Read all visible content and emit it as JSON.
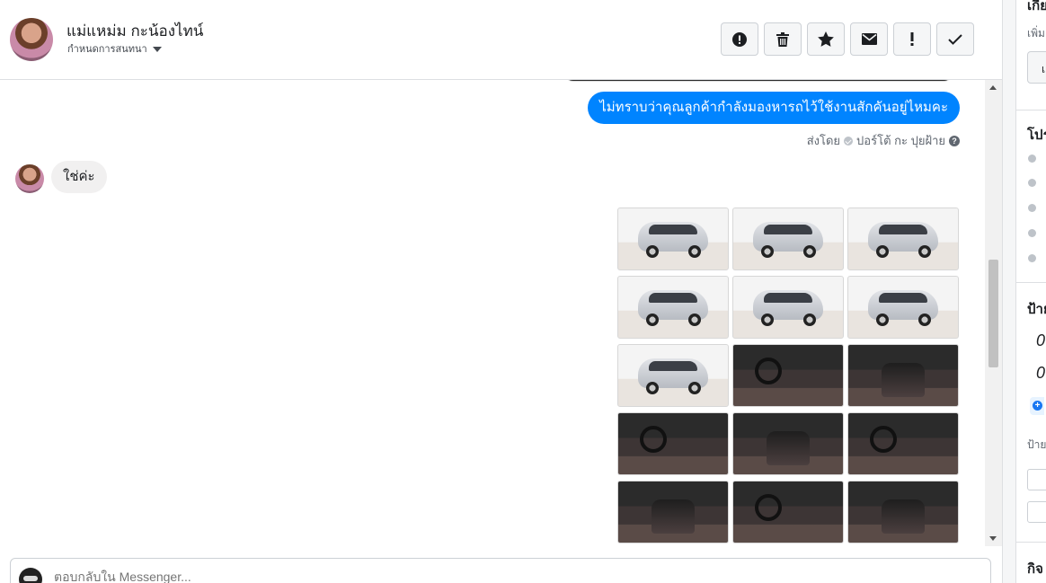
{
  "header": {
    "contact_name": "แม่แหม่ม กะน้องไทน์",
    "label_picker": "กำหนดการสนทนา",
    "actions": [
      {
        "name": "report-spam-icon"
      },
      {
        "name": "delete-icon"
      },
      {
        "name": "star-icon"
      },
      {
        "name": "mark-unread-icon"
      },
      {
        "name": "important-icon"
      },
      {
        "name": "done-check-icon"
      }
    ]
  },
  "conversation": {
    "outgoing_message": "ไม่ทราบว่าคุณลูกค้ากำลังมองหารถไว้ใช้งานสักคันอยู่ไหมคะ",
    "sent_by_prefix": "ส่งโดย",
    "sent_by_name": "ปอร์โต้ กะ ปุยฝ้าย",
    "incoming_message": "ใช่ค่ะ",
    "photos": [
      {
        "kind": "exterior",
        "view": "front-left"
      },
      {
        "kind": "exterior",
        "view": "front"
      },
      {
        "kind": "exterior",
        "view": "front-right"
      },
      {
        "kind": "exterior",
        "view": "rear-left"
      },
      {
        "kind": "exterior",
        "view": "rear"
      },
      {
        "kind": "exterior",
        "view": "side"
      },
      {
        "kind": "exterior",
        "view": "wheel"
      },
      {
        "kind": "interior",
        "view": "door"
      },
      {
        "kind": "interior",
        "view": "dashboard"
      },
      {
        "kind": "interior",
        "view": "steering"
      },
      {
        "kind": "interior",
        "view": "front-seats"
      },
      {
        "kind": "interior",
        "view": "cabin"
      },
      {
        "kind": "interior",
        "view": "rear-seats"
      },
      {
        "kind": "interior",
        "view": "seat-detail"
      },
      {
        "kind": "interior",
        "view": "cockpit"
      }
    ]
  },
  "reply": {
    "placeholder": "ตอบกลับใน Messenger..."
  },
  "side_panel": {
    "heading_1": "เกี่ย",
    "subtext_1": "เพิ่ม",
    "button_1": "เ",
    "heading_2": "โปร",
    "heading_3": "ป้าย",
    "value_1": "0",
    "value_2": "0",
    "subtext_2": "ป้าย",
    "heading_4": "กิจ"
  },
  "colors": {
    "outgoing_bubble": "#0084ff",
    "incoming_bubble": "#f1f0f0",
    "link_blue": "#1877f2"
  }
}
